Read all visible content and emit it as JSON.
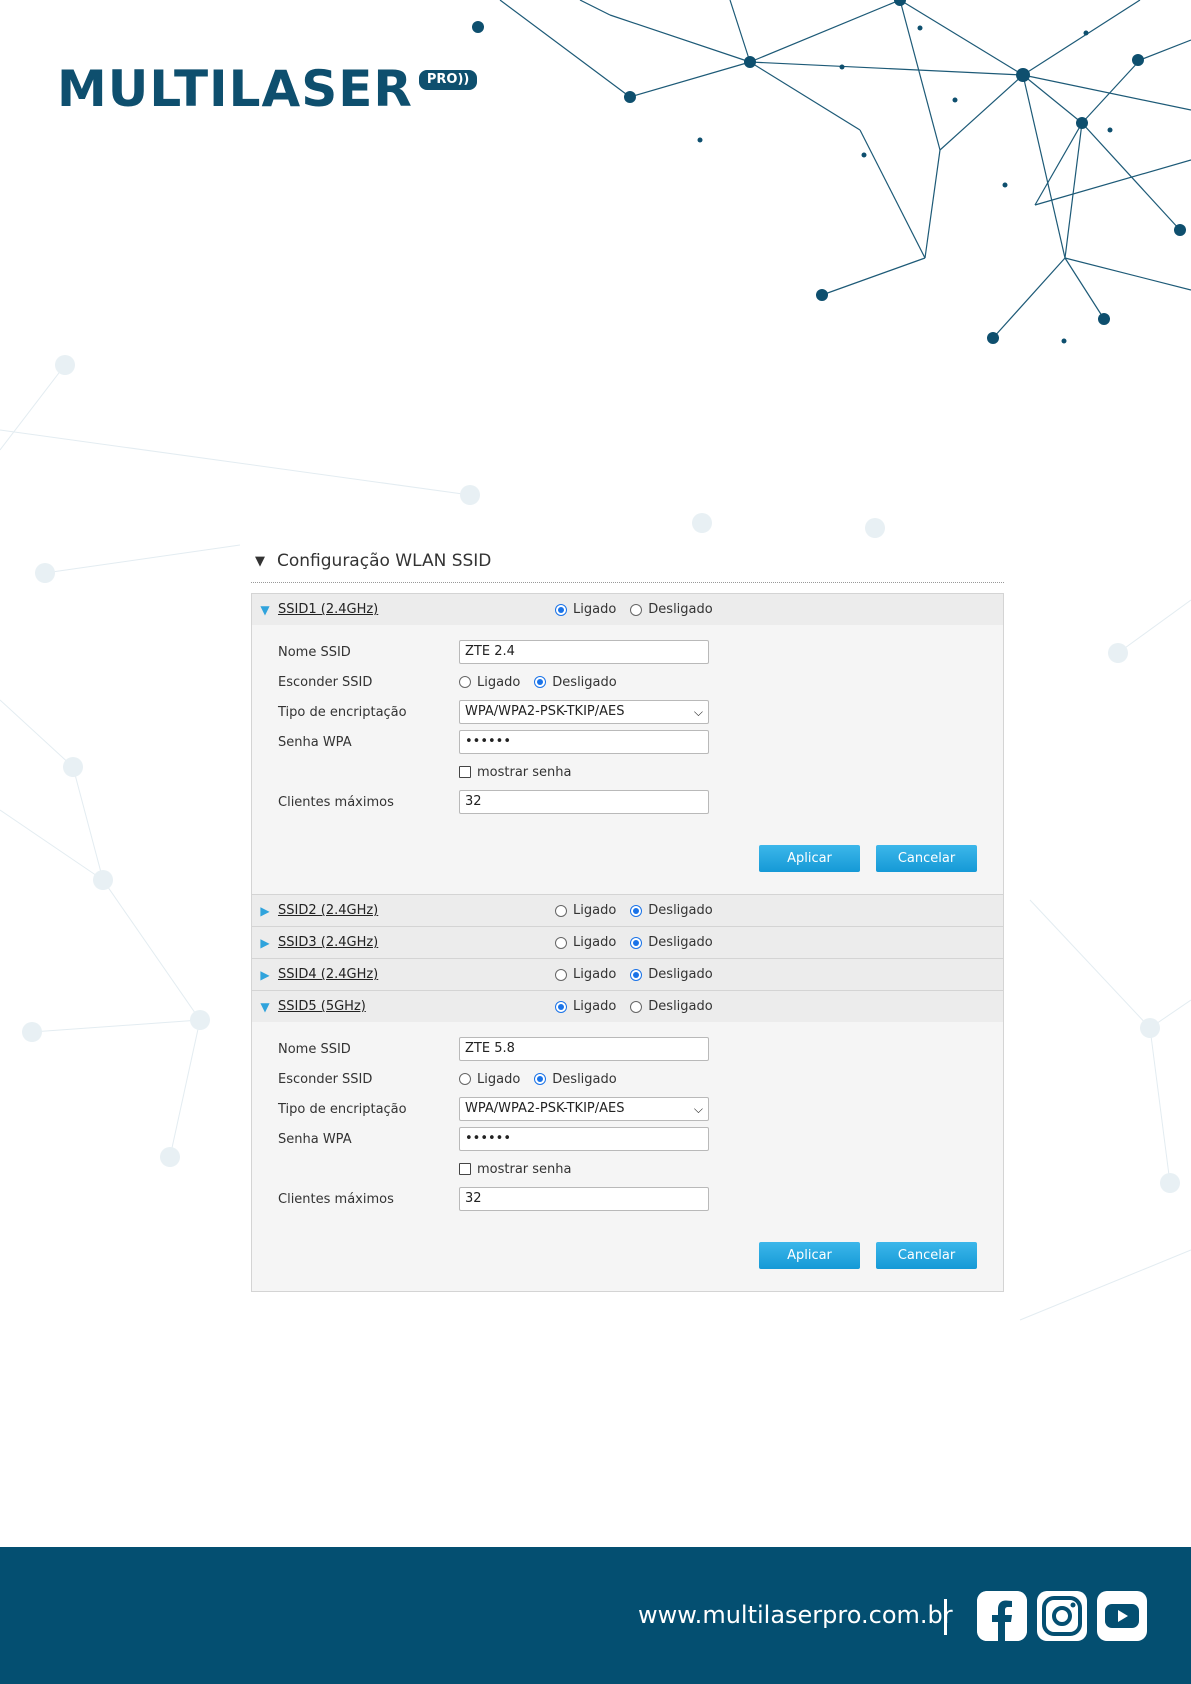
{
  "brand": {
    "name": "MULTILASER",
    "badge": "PRO))"
  },
  "section": {
    "title": "Configuração WLAN SSID"
  },
  "radio_labels": {
    "on": "Ligado",
    "off": "Desligado"
  },
  "fields": {
    "ssid_name": "Nome SSID",
    "hide_ssid": "Esconder SSID",
    "encryption": "Tipo de encriptação",
    "wpa_password": "Senha WPA",
    "show_password": "mostrar senha",
    "max_clients": "Clientes máximos"
  },
  "buttons": {
    "apply": "Aplicar",
    "cancel": "Cancelar"
  },
  "ssids": [
    {
      "name": "SSID1 (2.4GHz)",
      "enabled": true,
      "expanded": true,
      "ssid_value": "ZTE 2.4",
      "hidden": false,
      "encryption": "WPA/WPA2-PSK-TKIP/AES",
      "password": "••••••",
      "max_clients": "32"
    },
    {
      "name": "SSID2 (2.4GHz)",
      "enabled": false,
      "expanded": false
    },
    {
      "name": "SSID3 (2.4GHz)",
      "enabled": false,
      "expanded": false
    },
    {
      "name": "SSID4 (2.4GHz)",
      "enabled": false,
      "expanded": false
    },
    {
      "name": "SSID5 (5GHz)",
      "enabled": true,
      "expanded": true,
      "ssid_value": "ZTE 5.8",
      "hidden": false,
      "encryption": "WPA/WPA2-PSK-TKIP/AES",
      "password": "••••••",
      "max_clients": "32"
    }
  ],
  "footer": {
    "url": "www.multilaserpro.com.br"
  },
  "icons": {
    "facebook": "facebook-icon",
    "instagram": "instagram-icon",
    "youtube": "youtube-icon"
  },
  "colors": {
    "brand": "#0e4f6e",
    "footer": "#044f71",
    "accent": "#2fa3dc"
  }
}
